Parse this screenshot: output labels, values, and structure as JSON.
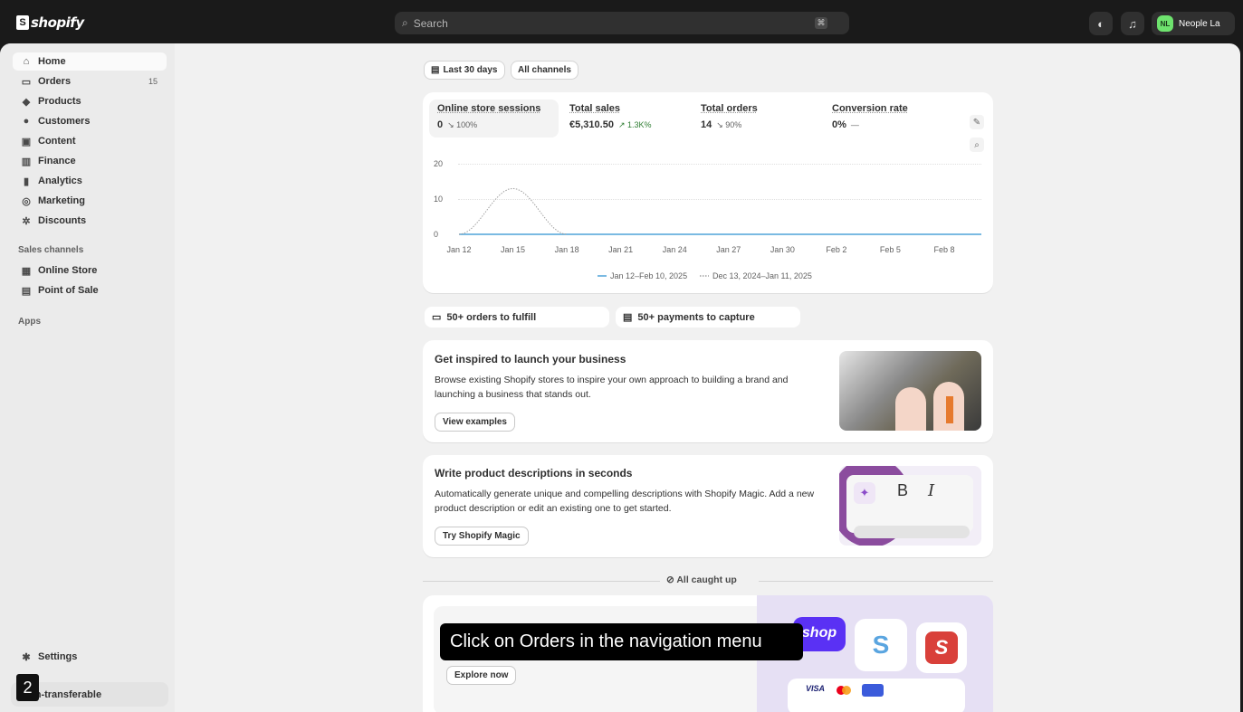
{
  "topbar": {
    "brand_word": "shopify",
    "search_placeholder": "Search",
    "search_kbd": "⌘",
    "store_initials": "NL",
    "store_name": "Neople La"
  },
  "sidebar": {
    "items": [
      {
        "label": "Home",
        "icon": "home-icon",
        "glyph": "⌂"
      },
      {
        "label": "Orders",
        "icon": "inbox-icon",
        "glyph": "▭",
        "count": "15"
      },
      {
        "label": "Products",
        "icon": "tag-icon",
        "glyph": "◆"
      },
      {
        "label": "Customers",
        "icon": "person-icon",
        "glyph": "●"
      },
      {
        "label": "Content",
        "icon": "content-icon",
        "glyph": "▣"
      },
      {
        "label": "Finance",
        "icon": "bank-icon",
        "glyph": "▥"
      },
      {
        "label": "Analytics",
        "icon": "bar-chart-icon",
        "glyph": "▮"
      },
      {
        "label": "Marketing",
        "icon": "target-icon",
        "glyph": "◎"
      },
      {
        "label": "Discounts",
        "icon": "discount-icon",
        "glyph": "✲"
      }
    ],
    "sales_channels_label": "Sales channels",
    "channels": [
      {
        "label": "Online Store",
        "icon": "store-icon",
        "glyph": "▦"
      },
      {
        "label": "Point of Sale",
        "icon": "pos-icon",
        "glyph": "▤"
      }
    ],
    "apps_label": "Apps",
    "settings_label": "Settings",
    "bottom_label": "on-transferable",
    "step_number": "2"
  },
  "filters": {
    "date_label": "Last 30 days",
    "channel_label": "All channels"
  },
  "metrics": [
    {
      "label": "Online store sessions",
      "value": "0",
      "delta": "↘ 100%"
    },
    {
      "label": "Total sales",
      "value": "€5,310.50",
      "delta": "↗ 1.3K%"
    },
    {
      "label": "Total orders",
      "value": "14",
      "delta": "↘ 90%"
    },
    {
      "label": "Conversion rate",
      "value": "0%",
      "delta": "—"
    }
  ],
  "chart_data": {
    "type": "line",
    "yticks": [
      "20",
      "10",
      "0"
    ],
    "ylim": [
      0,
      20
    ],
    "x": [
      "Jan 12",
      "Jan 15",
      "Jan 18",
      "Jan 21",
      "Jan 24",
      "Jan 27",
      "Jan 30",
      "Feb 2",
      "Feb 5",
      "Feb 8"
    ],
    "series": [
      {
        "name": "Jan 12–Feb 10, 2025",
        "color": "#4fa3d9",
        "style": "solid",
        "values": [
          0,
          0,
          0,
          0,
          0,
          0,
          0,
          0,
          0,
          0
        ]
      },
      {
        "name": "Dec 13, 2024–Jan 11, 2025",
        "color": "#a0a0a0",
        "style": "dotted",
        "values": [
          0,
          13,
          0,
          0,
          0,
          0,
          0,
          0,
          0,
          0
        ]
      }
    ]
  },
  "pills": {
    "fulfill": "50+ orders to fulfill",
    "capture": "50+ payments to capture"
  },
  "promo1": {
    "title": "Get inspired to launch your business",
    "body": "Browse existing Shopify stores to inspire your own approach to building a brand and launching a business that stands out.",
    "button": "View examples"
  },
  "promo2": {
    "title": "Write product descriptions in seconds",
    "body": "Automatically generate unique and compelling descriptions with Shopify Magic. Add a new product description or edit an existing one to get started.",
    "button": "Try Shopify Magic"
  },
  "caught_up": "All caught up",
  "promo3": {
    "button": "Explore now",
    "shop_word": "shop",
    "visa": "VISA"
  },
  "instruction": "Click on Orders in the navigation menu"
}
